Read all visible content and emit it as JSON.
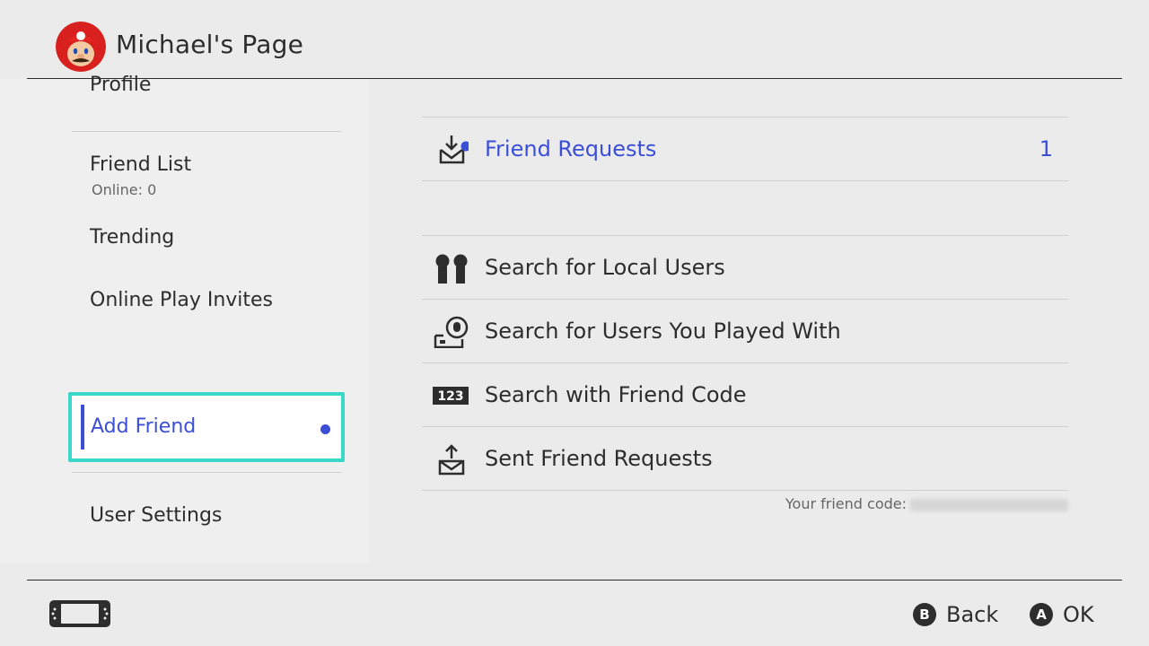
{
  "header": {
    "title": "Michael's Page"
  },
  "sidebar": {
    "items": [
      {
        "label": "Profile"
      },
      {
        "label": "Friend List",
        "sub": "Online: 0"
      },
      {
        "label": "Trending"
      },
      {
        "label": "Online Play Invites"
      },
      {
        "label": "Add Friend",
        "selected": true,
        "notification": true
      },
      {
        "label": "User Settings"
      }
    ]
  },
  "main": {
    "rows": [
      {
        "label": "Friend Requests",
        "count": "1",
        "icon": "inbox-download-icon"
      },
      {
        "label": "Search for Local Users",
        "icon": "local-users-icon"
      },
      {
        "label": "Search for Users You Played With",
        "icon": "played-with-icon"
      },
      {
        "label": "Search with Friend Code",
        "icon": "friend-code-icon",
        "icon_text": "123"
      },
      {
        "label": "Sent Friend Requests",
        "icon": "outbox-upload-icon"
      }
    ],
    "friend_code_label": "Your friend code:"
  },
  "footer": {
    "back_key": "B",
    "back_label": "Back",
    "ok_key": "A",
    "ok_label": "OK"
  },
  "colors": {
    "accent": "#3b4fd6",
    "selection_border": "#3ad8c8",
    "background": "#ebebeb",
    "text": "#2d2d2d"
  }
}
